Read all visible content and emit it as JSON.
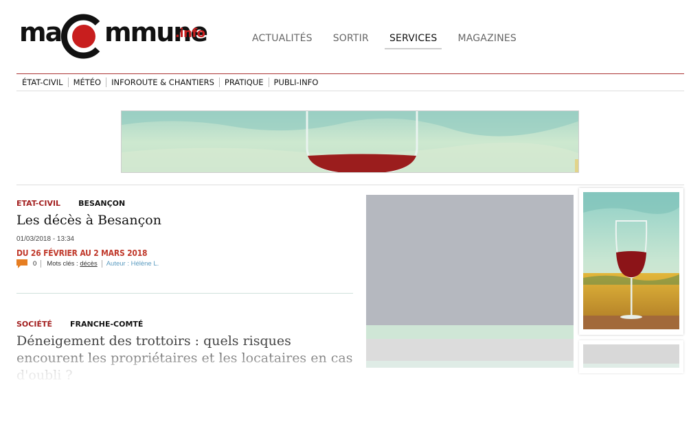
{
  "logo": {
    "prefix": "ma",
    "rest": "mmune",
    "suffix": ".info",
    "brand_red": "#c81e1e"
  },
  "main_nav": [
    {
      "label": "ACTUALITÉS",
      "active": false
    },
    {
      "label": "SORTIR",
      "active": false
    },
    {
      "label": "SERVICES",
      "active": true
    },
    {
      "label": "MAGAZINES",
      "active": false
    }
  ],
  "sub_nav": [
    "ÉTAT-CIVIL",
    "MÉTÉO",
    "INFOROUTE & CHANTIERS",
    "PRATIQUE",
    "PUBLI-INFO"
  ],
  "banner": {
    "image": "wine-glass-banner"
  },
  "articles": [
    {
      "category": "ETAT-CIVIL",
      "location": "BESANÇON",
      "title": "Les décès à Besançon",
      "date": "01/03/2018 - 13:34",
      "subtitle": "DU 26 FÉVRIER AU 2 MARS 2018",
      "comments": "0",
      "keywords_label": "Mots clés :",
      "keyword": "décès",
      "author": "Auteur : Hélène L."
    },
    {
      "category": "SOCIÉTÉ",
      "location": "FRANCHE-COMTÉ",
      "title": "Déneigement des trottoirs : quels risques encourent les propriétaires et les locataires en cas d'oubli ?"
    }
  ],
  "colors": {
    "accent_red": "#a32020",
    "author_blue": "#5b9bc0",
    "comment_orange": "#e67e22"
  },
  "thumb": {
    "image": "wine-glass-thumbnail"
  }
}
